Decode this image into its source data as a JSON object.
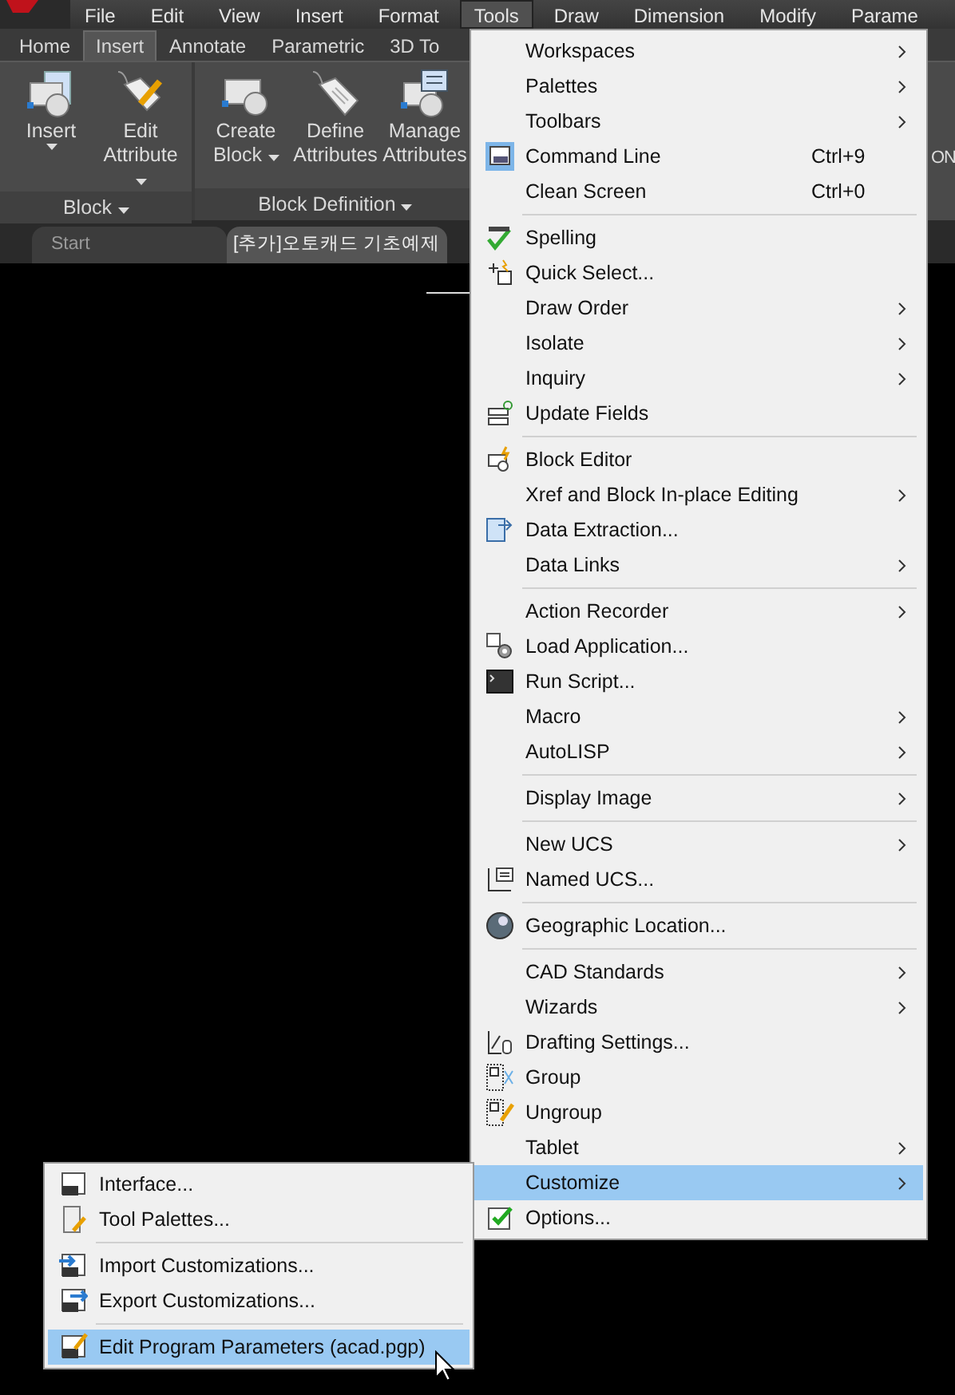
{
  "menubar": [
    {
      "label": "File",
      "selected": false
    },
    {
      "label": "Edit",
      "selected": false
    },
    {
      "label": "View",
      "selected": false
    },
    {
      "label": "Insert",
      "selected": false
    },
    {
      "label": "Format",
      "selected": false
    },
    {
      "label": "Tools",
      "selected": true
    },
    {
      "label": "Draw",
      "selected": false
    },
    {
      "label": "Dimension",
      "selected": false
    },
    {
      "label": "Modify",
      "selected": false
    },
    {
      "label": "Parame",
      "selected": false
    }
  ],
  "ribbon_tabs": [
    {
      "label": "Home",
      "selected": false
    },
    {
      "label": "Insert",
      "selected": true
    },
    {
      "label": "Annotate",
      "selected": false
    },
    {
      "label": "Parametric",
      "selected": false
    },
    {
      "label": "3D To",
      "selected": false
    }
  ],
  "ribbon_panels": [
    {
      "label": "Block",
      "buttons": [
        {
          "label": "Insert",
          "kind": "split-below"
        },
        {
          "label": "Edit Attribute",
          "kind": "split-side"
        }
      ]
    },
    {
      "label": "Block Definition",
      "buttons": [
        {
          "label": "Create Block",
          "kind": "split-side"
        },
        {
          "label": "Define Attributes",
          "kind": "plain"
        },
        {
          "label": "Manage Attributes",
          "kind": "plain"
        }
      ]
    }
  ],
  "ribbon_fragment": "ON",
  "doc_tabs": [
    {
      "label": "Start",
      "selected": false
    },
    {
      "label": "[추가]오토캐드 기초예제",
      "selected": true
    }
  ],
  "tools_menu": [
    [
      {
        "label": "Workspaces",
        "submenu": true,
        "selected": false
      },
      {
        "label": "Palettes",
        "submenu": true,
        "selected": false
      },
      {
        "label": "Toolbars",
        "submenu": true,
        "selected": false
      },
      {
        "label": "Command Line",
        "shortcut": "Ctrl+9",
        "submenu": false,
        "checked": true,
        "selected": false
      },
      {
        "label": "Clean Screen",
        "shortcut": "Ctrl+0",
        "submenu": false,
        "selected": false
      }
    ],
    [
      {
        "label": "Spelling",
        "submenu": false,
        "selected": false
      },
      {
        "label": "Quick Select...",
        "submenu": false,
        "selected": false
      },
      {
        "label": "Draw Order",
        "submenu": true,
        "selected": false
      },
      {
        "label": "Isolate",
        "submenu": true,
        "selected": false
      },
      {
        "label": "Inquiry",
        "submenu": true,
        "selected": false
      },
      {
        "label": "Update Fields",
        "submenu": false,
        "selected": false
      }
    ],
    [
      {
        "label": "Block Editor",
        "submenu": false,
        "selected": false
      },
      {
        "label": "Xref and Block In-place Editing",
        "submenu": true,
        "selected": false
      },
      {
        "label": "Data Extraction...",
        "submenu": false,
        "selected": false
      },
      {
        "label": "Data Links",
        "submenu": true,
        "selected": false
      }
    ],
    [
      {
        "label": "Action Recorder",
        "submenu": true,
        "selected": false
      },
      {
        "label": "Load Application...",
        "submenu": false,
        "selected": false
      },
      {
        "label": "Run Script...",
        "submenu": false,
        "selected": false
      },
      {
        "label": "Macro",
        "submenu": true,
        "selected": false
      },
      {
        "label": "AutoLISP",
        "submenu": true,
        "selected": false
      }
    ],
    [
      {
        "label": "Display Image",
        "submenu": true,
        "selected": false
      }
    ],
    [
      {
        "label": "New UCS",
        "submenu": true,
        "selected": false
      },
      {
        "label": "Named UCS...",
        "submenu": false,
        "selected": false
      }
    ],
    [
      {
        "label": "Geographic Location...",
        "submenu": false,
        "selected": false
      }
    ],
    [
      {
        "label": "CAD Standards",
        "submenu": true,
        "selected": false
      },
      {
        "label": "Wizards",
        "submenu": true,
        "selected": false
      },
      {
        "label": "Drafting Settings...",
        "submenu": false,
        "selected": false
      },
      {
        "label": "Group",
        "submenu": false,
        "selected": false
      },
      {
        "label": "Ungroup",
        "submenu": false,
        "selected": false
      },
      {
        "label": "Tablet",
        "submenu": true,
        "selected": false
      },
      {
        "label": "Customize",
        "submenu": true,
        "selected": true
      },
      {
        "label": "Options...",
        "submenu": false,
        "selected": false
      }
    ]
  ],
  "customize_menu": [
    [
      {
        "label": "Interface...",
        "selected": false
      },
      {
        "label": "Tool Palettes...",
        "selected": false
      }
    ],
    [
      {
        "label": "Import Customizations...",
        "selected": false
      },
      {
        "label": "Export Customizations...",
        "selected": false
      }
    ],
    [
      {
        "label": "Edit Program Parameters (acad.pgp)",
        "selected": true
      }
    ]
  ]
}
